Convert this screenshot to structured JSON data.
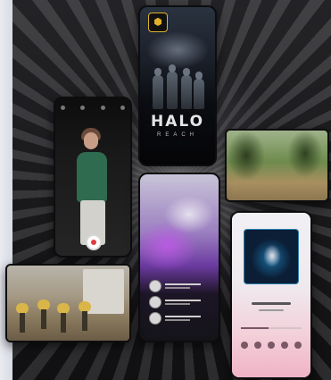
{
  "scene": {
    "description_kind": "promotional collage of devices",
    "devices": [
      {
        "id": "halo-phone",
        "wordmark": "HALO",
        "subtitle": "REACH"
      },
      {
        "id": "portrait-phone"
      },
      {
        "id": "forest-tablet"
      },
      {
        "id": "glitter-phone"
      },
      {
        "id": "robots-tablet"
      },
      {
        "id": "music-phone",
        "progress": 0.45
      }
    ]
  },
  "colors": {
    "background": "#1b1b1d",
    "halo_badge": "#e0b12a",
    "shutter_red": "#e23b3b",
    "music_pink": "#f0b3c6"
  },
  "icons": [
    "halo-badge-icon",
    "shutter-button-icon"
  ]
}
